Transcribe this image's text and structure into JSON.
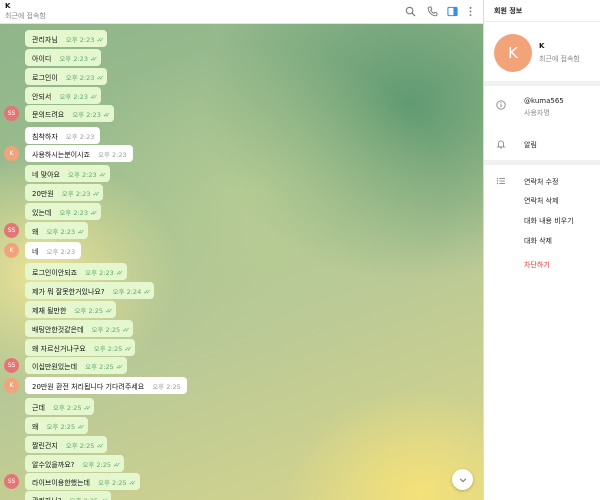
{
  "header": {
    "title": "K",
    "status": "최근에 접속함"
  },
  "messages": [
    {
      "text": "관리자님",
      "time": "오후 2:23",
      "dir": "out"
    },
    {
      "text": "아이디",
      "time": "오후 2:23",
      "dir": "out"
    },
    {
      "text": "로그인이",
      "time": "오후 2:23",
      "dir": "out"
    },
    {
      "text": "안되서",
      "time": "오후 2:23",
      "dir": "out"
    },
    {
      "text": "문의드려요",
      "time": "오후 2:23",
      "dir": "out",
      "avatar": "SS"
    },
    {
      "text": "침착하자",
      "time": "오후 2:23",
      "dir": "in"
    },
    {
      "text": "사용하시는분이시죠",
      "time": "오후 2:23",
      "dir": "in",
      "avatar": "K"
    },
    {
      "text": "네 맞아요",
      "time": "오후 2:23",
      "dir": "out"
    },
    {
      "text": "20만원",
      "time": "오후 2:23",
      "dir": "out"
    },
    {
      "text": "있는데",
      "time": "오후 2:23",
      "dir": "out"
    },
    {
      "text": "왜",
      "time": "오후 2:23",
      "dir": "out",
      "avatar": "SS"
    },
    {
      "text": "네",
      "time": "오후 2:23",
      "dir": "in",
      "avatar": "K"
    },
    {
      "text": "로그인이안되죠",
      "time": "오후 2:23",
      "dir": "out"
    },
    {
      "text": "제가 뭐 잘못한거있나요?",
      "time": "오후 2:24",
      "dir": "out"
    },
    {
      "text": "제재 될만한",
      "time": "오후 2:25",
      "dir": "out"
    },
    {
      "text": "배팅안한것같은데",
      "time": "오후 2:25",
      "dir": "out"
    },
    {
      "text": "왜 자르신거냐구요",
      "time": "오후 2:25",
      "dir": "out"
    },
    {
      "text": "이십만원있는데",
      "time": "오후 2:25",
      "dir": "out",
      "avatar": "SS"
    },
    {
      "text": "20만원 환전 처리됩니다 기다려주세요",
      "time": "오후 2:25",
      "dir": "in",
      "avatar": "K"
    },
    {
      "text": "근데",
      "time": "오후 2:25",
      "dir": "out"
    },
    {
      "text": "왜",
      "time": "오후 2:25",
      "dir": "out"
    },
    {
      "text": "짤린건지",
      "time": "오후 2:25",
      "dir": "out"
    },
    {
      "text": "알수있을까요?",
      "time": "오후 2:25",
      "dir": "out"
    },
    {
      "text": "라이브이용한했는데",
      "time": "오후 2:25",
      "dir": "out",
      "avatar": "SS"
    },
    {
      "text": "관리자님?",
      "time": "오후 2:25",
      "dir": "out"
    }
  ],
  "panel": {
    "title": "회원 정보",
    "avatar_letter": "K",
    "name": "K",
    "status": "최근에 접속함",
    "username": "@kuma565",
    "username_label": "사용자명",
    "notifications": "알림",
    "actions": [
      "연락처 수정",
      "연락처 삭제",
      "대화 내용 비우기",
      "대화 삭제"
    ],
    "block": "차단하기"
  },
  "colors": {
    "outgoing_bubble": "#e4f7cf",
    "incoming_bubble": "#ffffff",
    "check_green": "#5fa865",
    "avatar_ss": "#e37674",
    "avatar_k": "#f2a37a",
    "danger": "#e53935"
  },
  "icons": [
    "search-icon",
    "phone-icon",
    "sidebar-toggle-icon",
    "more-vertical-icon",
    "info-icon",
    "bell-icon",
    "list-icon",
    "chevron-down-icon"
  ]
}
